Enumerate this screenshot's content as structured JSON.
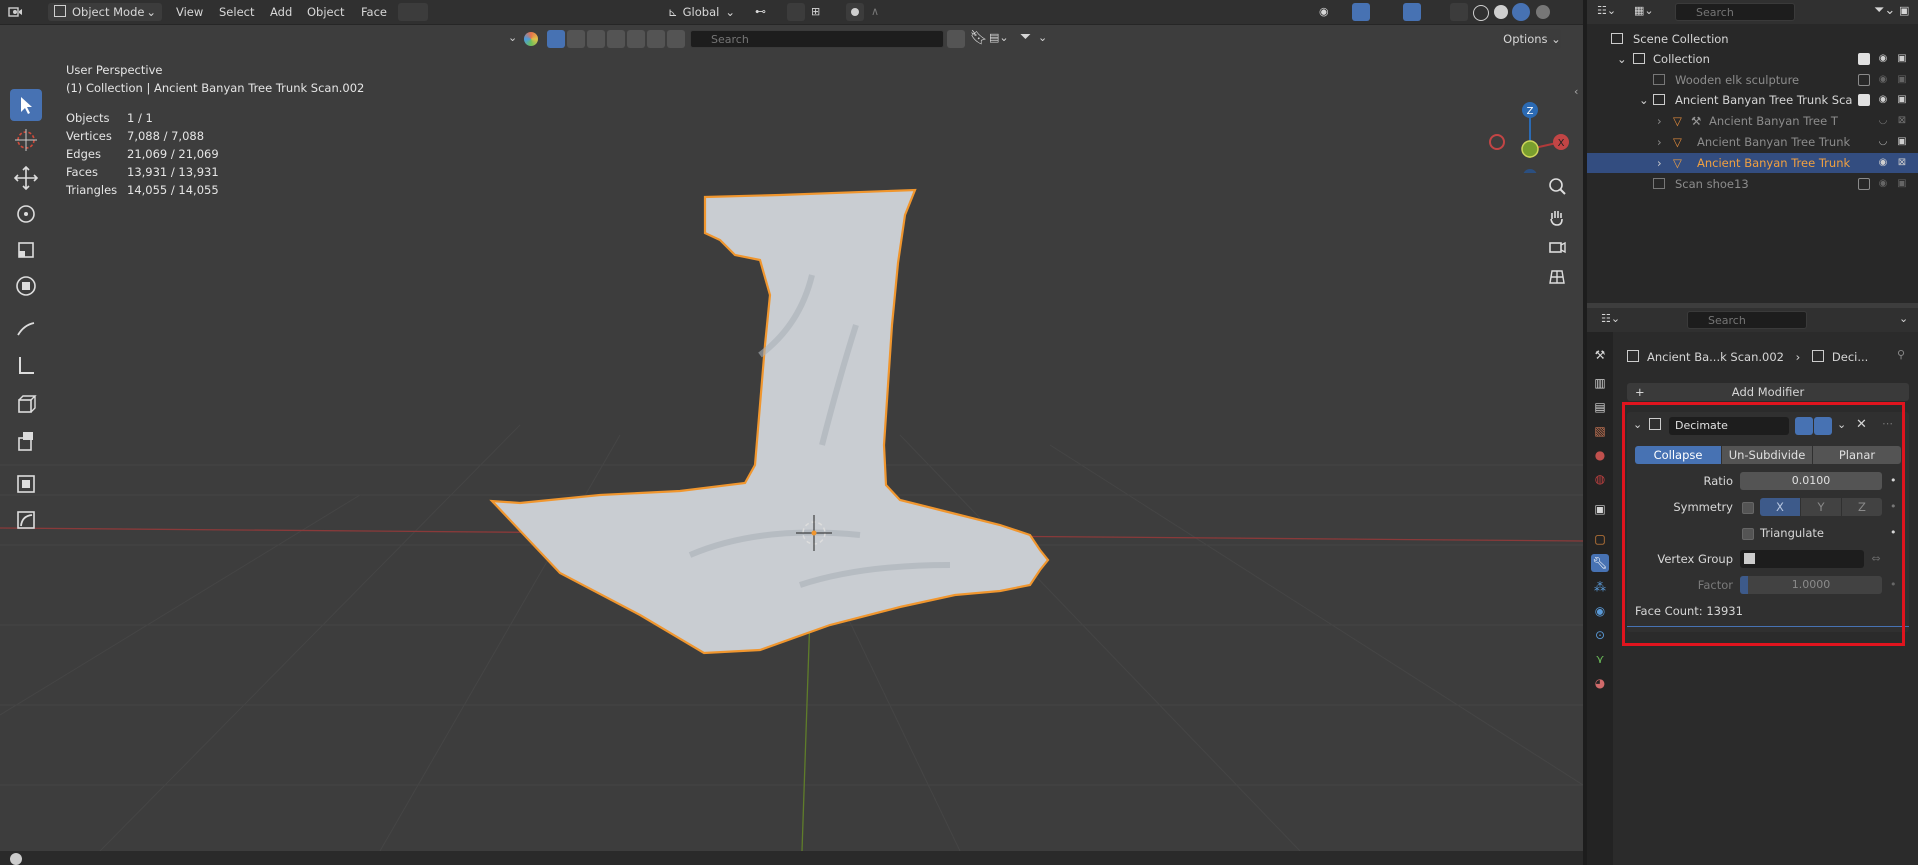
{
  "header": {
    "mode": "Object Mode",
    "menus": [
      "View",
      "Select",
      "Add",
      "Object",
      "Face"
    ],
    "transform_orientation": "Global"
  },
  "viewport": {
    "search_placeholder": "Search",
    "options_label": "Options",
    "perspective": "User Perspective",
    "collection_line": "(1) Collection | Ancient Banyan Tree Trunk Scan.002",
    "stats": [
      {
        "label": "Objects",
        "value": "1 / 1"
      },
      {
        "label": "Vertices",
        "value": "7,088 / 7,088"
      },
      {
        "label": "Edges",
        "value": "21,069 / 21,069"
      },
      {
        "label": "Faces",
        "value": "13,931 / 13,931"
      },
      {
        "label": "Triangles",
        "value": "14,055 / 14,055"
      }
    ],
    "gizmo": {
      "z": "Z",
      "x": "X"
    },
    "colors": {
      "selection_outline": "#f4a24a",
      "x_axis": "#a63535",
      "y_axis": "#6b8e23"
    }
  },
  "outliner": {
    "search_placeholder": "Search",
    "scene_collection": "Scene Collection",
    "rows": [
      {
        "label": "Collection"
      },
      {
        "label": "Wooden elk sculpture"
      },
      {
        "label": "Ancient Banyan Tree Trunk Sca"
      },
      {
        "label": "Ancient Banyan Tree T"
      },
      {
        "label": "Ancient Banyan Tree Trunk"
      },
      {
        "label": "Ancient Banyan Tree Trunk"
      },
      {
        "label": "Scan shoe13"
      }
    ]
  },
  "properties": {
    "search_placeholder": "Search",
    "breadcrumb_object": "Ancient Ba...k Scan.002",
    "breadcrumb_modifier": "Deci...",
    "add_modifier": "Add Modifier",
    "modifier": {
      "name": "Decimate",
      "modes": [
        "Collapse",
        "Un-Subdivide",
        "Planar"
      ],
      "active_mode": "Collapse",
      "ratio_label": "Ratio",
      "ratio_value": "0.0100",
      "symmetry_label": "Symmetry",
      "axes": [
        "X",
        "Y",
        "Z"
      ],
      "triangulate_label": "Triangulate",
      "vertex_group_label": "Vertex Group",
      "factor_label": "Factor",
      "factor_value": "1.0000",
      "face_count": "Face Count: 13931"
    },
    "highlight_color": "#e0141e"
  }
}
